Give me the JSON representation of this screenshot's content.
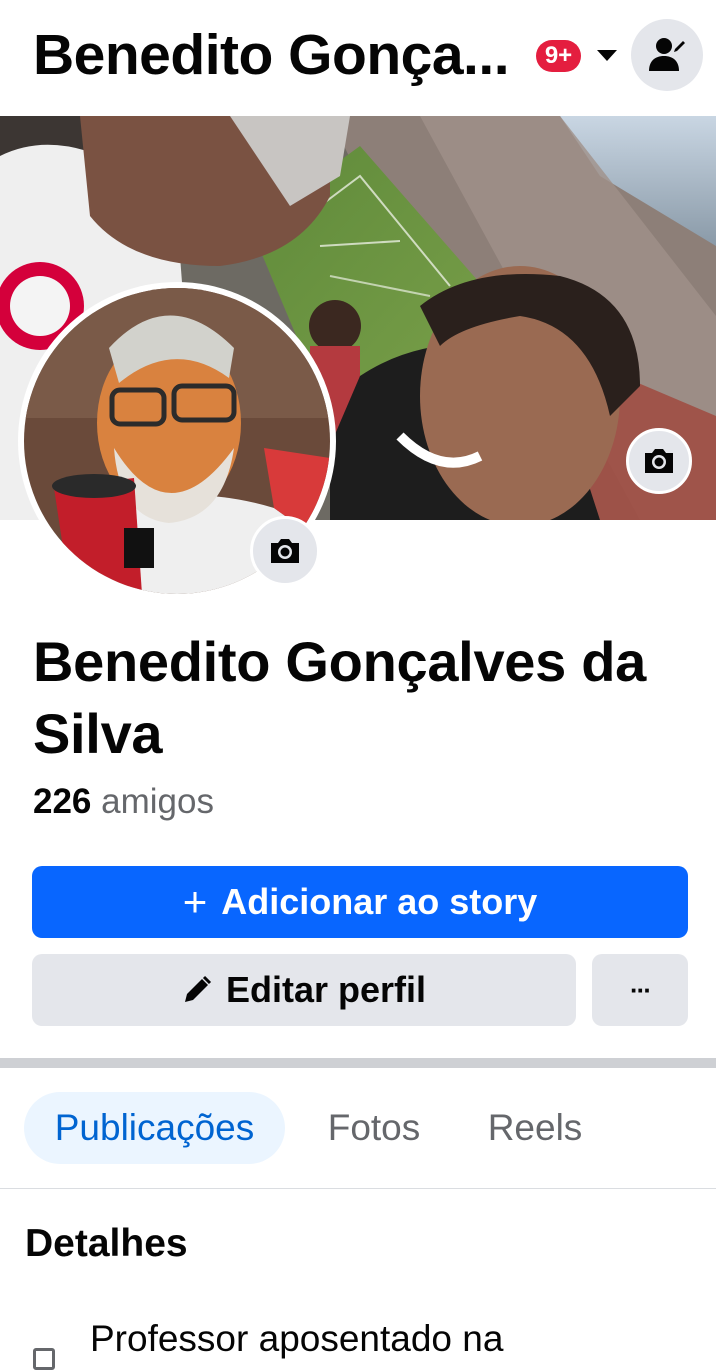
{
  "header": {
    "title": "Benedito Gonça...",
    "notification_badge": "9+",
    "icons": [
      "chevron-down-icon",
      "profile-switch-icon"
    ]
  },
  "profile": {
    "name": "Benedito Gonçalves da Silva",
    "friends_count": "226",
    "friends_label": "amigos"
  },
  "buttons": {
    "add_story_icon": "+",
    "add_story": "Adicionar ao story",
    "edit_profile": "Editar perfil",
    "more": "···"
  },
  "tabs": [
    {
      "label": "Publicações",
      "active": true
    },
    {
      "label": "Fotos",
      "active": false
    },
    {
      "label": "Reels",
      "active": false
    }
  ],
  "details": {
    "title": "Detalhes",
    "items": [
      {
        "icon": "briefcase-icon",
        "text": "Professor aposentado na"
      }
    ]
  },
  "colors": {
    "accent": "#0866ff",
    "badge": "#e41e3f",
    "secondary_button": "#e4e6eb",
    "active_tab_bg": "#ebf5ff",
    "active_tab_text": "#0064d1"
  }
}
